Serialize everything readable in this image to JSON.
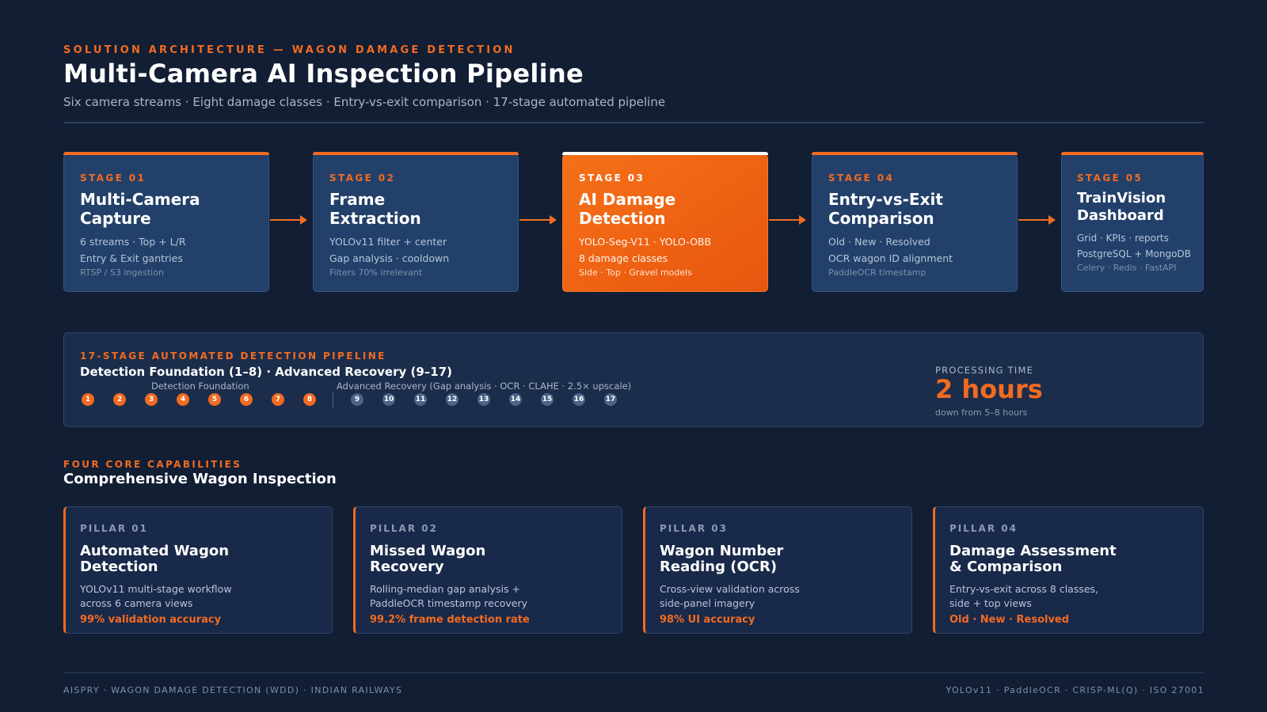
{
  "header": {
    "eyebrow": "SOLUTION ARCHITECTURE — WAGON DAMAGE DETECTION",
    "title": "Multi-Camera AI Inspection Pipeline",
    "subtitle": "Six camera streams · Eight damage classes · Entry-vs-exit comparison · 17-stage automated pipeline"
  },
  "stages": [
    {
      "label": "STAGE 01",
      "title_1": "Multi-Camera",
      "title_2": "Capture",
      "line1": "6 streams · Top + L/R",
      "line2": "Entry & Exit gantries",
      "line3": "RTSP / S3 ingestion"
    },
    {
      "label": "STAGE 02",
      "title_1": "Frame",
      "title_2": "Extraction",
      "line1": "YOLOv11 filter + center",
      "line2": "Gap analysis · cooldown",
      "line3": "Filters 70% irrelevant"
    },
    {
      "label": "STAGE 03",
      "title_1": "AI Damage",
      "title_2": "Detection",
      "line1": "YOLO-Seg-V11 · YOLO-OBB",
      "line2": "8 damage classes",
      "line3": "Side · Top · Gravel models"
    },
    {
      "label": "STAGE 04",
      "title_1": "Entry-vs-Exit",
      "title_2": "Comparison",
      "line1": "Old · New · Resolved",
      "line2": "OCR wagon ID alignment",
      "line3": "PaddleOCR timestamp"
    },
    {
      "label": "STAGE 05",
      "title_1": "TrainVision",
      "title_2": "Dashboard",
      "line1": "Grid · KPIs · reports",
      "line2": "PostgreSQL + MongoDB",
      "line3": "Celery · Redis · FastAPI"
    }
  ],
  "pipeline": {
    "eyebrow": "17-STAGE AUTOMATED DETECTION PIPELINE",
    "title": "Detection Foundation (1–8) · Advanced Recovery (9–17)",
    "group_foundation": "Detection Foundation",
    "group_recovery": "Advanced Recovery (Gap analysis · OCR · CLAHE · 2.5× upscale)",
    "steps": [
      "1",
      "2",
      "3",
      "4",
      "5",
      "6",
      "7",
      "8",
      "9",
      "10",
      "11",
      "12",
      "13",
      "14",
      "15",
      "16",
      "17"
    ],
    "processing_label": "PROCESSING TIME",
    "processing_value": "2 hours",
    "processing_note": "down from 5–8 hours"
  },
  "capabilities": {
    "eyebrow": "FOUR CORE CAPABILITIES",
    "title": "Comprehensive Wagon Inspection",
    "pillars": [
      {
        "label": "PILLAR 01",
        "title_1": "Automated Wagon",
        "title_2": "Detection",
        "desc_1": "YOLOv11 multi-stage workflow",
        "desc_2": "across 6 camera views",
        "metric": "99% validation accuracy"
      },
      {
        "label": "PILLAR 02",
        "title_1": "Missed Wagon",
        "title_2": "Recovery",
        "desc_1": "Rolling-median gap analysis +",
        "desc_2": "PaddleOCR timestamp recovery",
        "metric": "99.2% frame detection rate"
      },
      {
        "label": "PILLAR 03",
        "title_1": "Wagon Number",
        "title_2": "Reading (OCR)",
        "desc_1": "Cross-view validation across",
        "desc_2": "side-panel imagery",
        "metric": "98% UI accuracy"
      },
      {
        "label": "PILLAR 04",
        "title_1": "Damage Assessment",
        "title_2": "& Comparison",
        "desc_1": "Entry-vs-exit across 8 classes,",
        "desc_2": "side + top views",
        "metric": "Old · New · Resolved"
      }
    ]
  },
  "footer": {
    "left": "AISPRY · WAGON DAMAGE DETECTION (WDD) · INDIAN RAILWAYS",
    "right": "YOLOv11 · PaddleOCR · CRISP-ML(Q) · ISO 27001"
  },
  "colors": {
    "background": "#111e33",
    "accent": "#f26b21",
    "card": "#22406a",
    "active_card": "#f26b21"
  }
}
